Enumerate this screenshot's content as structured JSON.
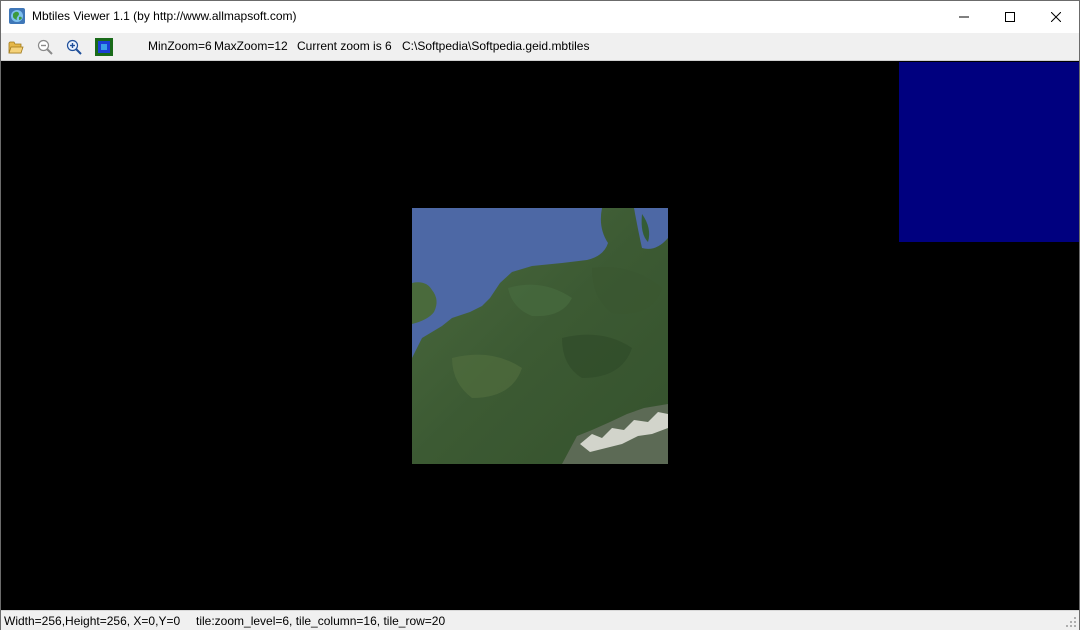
{
  "window": {
    "title": "Mbtiles Viewer  1.1  (by http://www.allmapsoft.com)"
  },
  "toolbar": {
    "min_zoom": "MinZoom=6",
    "max_zoom": "MaxZoom=12",
    "current_zoom": "Current zoom is 6",
    "file_path": "C:\\Softpedia\\Softpedia.geid.mbtiles"
  },
  "statusbar": {
    "dimensions": "Width=256,Height=256, X=0,Y=0",
    "tile_info": "tile:zoom_level=6, tile_column=16, tile_row=20"
  },
  "colors": {
    "map_background": "#000000",
    "overview_panel": "#00007f",
    "sea": "#4d68a5",
    "land": "#3f5f35"
  }
}
